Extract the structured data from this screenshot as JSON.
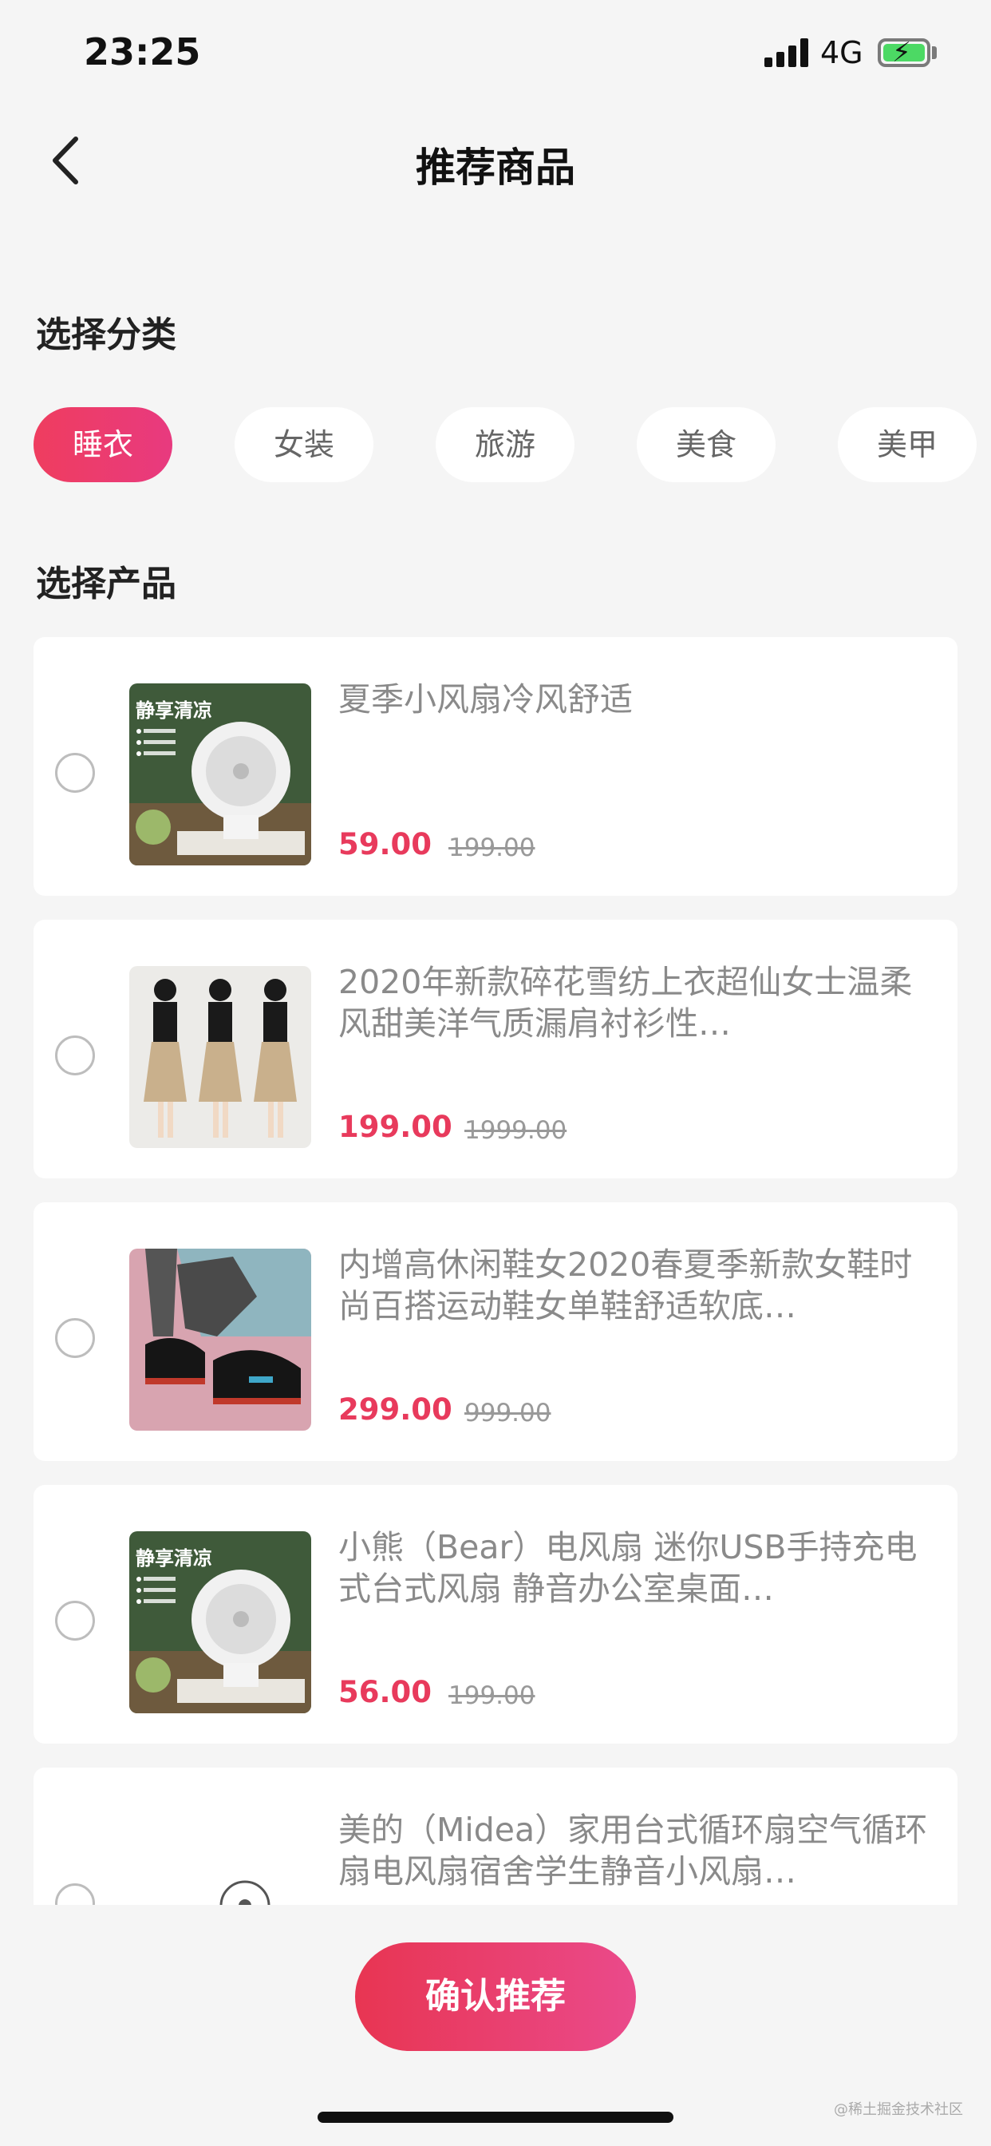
{
  "status_bar": {
    "time": "23:25",
    "network": "4G"
  },
  "nav": {
    "title": "推荐商品"
  },
  "category_section": {
    "title": "选择分类",
    "chips": [
      {
        "label": "睡衣",
        "active": true
      },
      {
        "label": "女装",
        "active": false
      },
      {
        "label": "旅游",
        "active": false
      },
      {
        "label": "美食",
        "active": false
      },
      {
        "label": "美甲",
        "active": false
      }
    ]
  },
  "product_section": {
    "title": "选择产品",
    "products": [
      {
        "title": "夏季小风扇冷风舒适",
        "price": "59.00",
        "original_price": "199.00",
        "image": "desk-fan-photo",
        "image_text": "静享清凉"
      },
      {
        "title": "2020年新款碎花雪纺上衣超仙女士温柔风甜美洋气质漏肩衬衫性…",
        "price": "199.00",
        "original_price": "1999.00",
        "image": "dress-models-photo"
      },
      {
        "title": "内增高休闲鞋女2020春夏季新款女鞋时尚百搭运动鞋女单鞋舒适软底…",
        "price": "299.00",
        "original_price": "999.00",
        "image": "sneakers-photo"
      },
      {
        "title": "小熊（Bear）电风扇 迷你USB手持充电式台式风扇 静音办公室桌面…",
        "price": "56.00",
        "original_price": "199.00",
        "image": "desk-fan-photo",
        "image_text": "静享清凉"
      },
      {
        "title": "美的（Midea）家用台式循环扇空气循环扇电风扇宿舍学生静音小风扇…",
        "price": "",
        "original_price": "",
        "image": "circulator-fan-photo"
      }
    ]
  },
  "confirm_button": {
    "label": "确认推荐"
  },
  "watermark": "@稀土掘金技术社区",
  "colors": {
    "accent": "#e83a5c",
    "background": "#f5f5f5"
  }
}
